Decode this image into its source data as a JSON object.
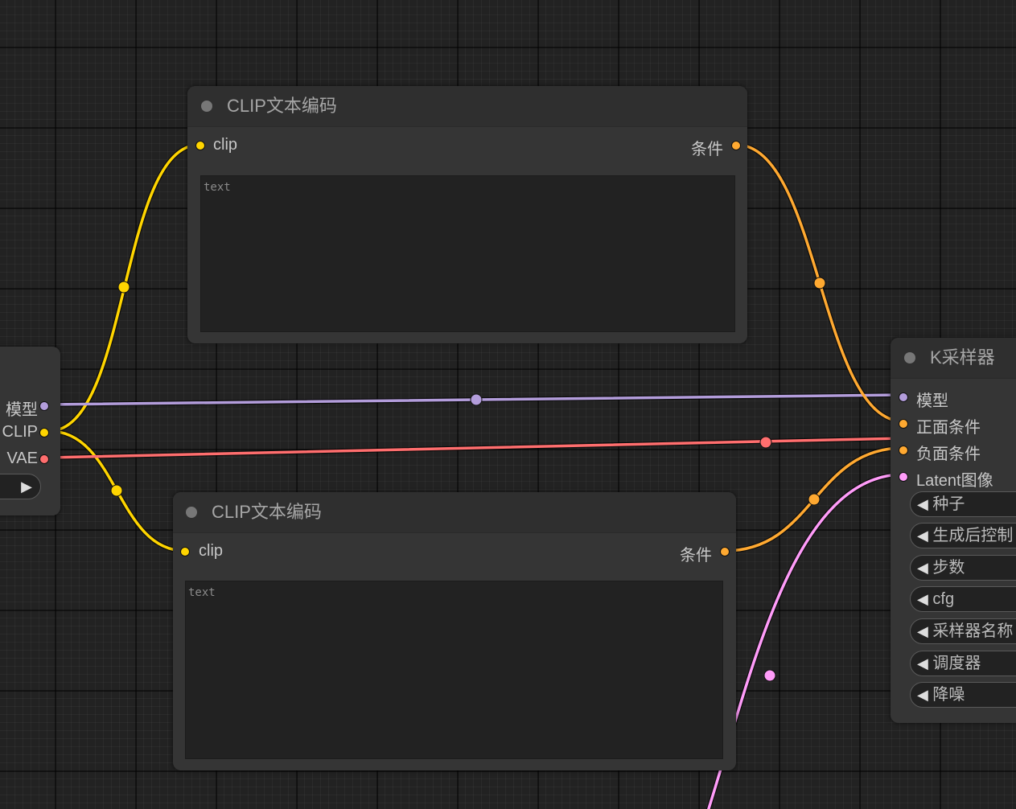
{
  "colors": {
    "clip": "#ffd500",
    "model": "#b39ddb",
    "vae": "#ff6e6e",
    "conditioning": "#ffa931",
    "latent": "#ff9cf9"
  },
  "loader_node": {
    "outputs": [
      {
        "label": "模型",
        "type": "model"
      },
      {
        "label": "CLIP",
        "type": "clip"
      },
      {
        "label": "VAE",
        "type": "vae"
      }
    ],
    "button_icon": "play-icon"
  },
  "clip_encode_top": {
    "title": "CLIP文本编码",
    "input_label": "clip",
    "output_label": "条件",
    "text_placeholder": "text"
  },
  "clip_encode_bottom": {
    "title": "CLIP文本编码",
    "input_label": "clip",
    "output_label": "条件",
    "text_placeholder": "text"
  },
  "ksampler": {
    "title": "K采样器",
    "inputs": [
      {
        "label": "模型",
        "type": "model"
      },
      {
        "label": "正面条件",
        "type": "conditioning"
      },
      {
        "label": "负面条件",
        "type": "conditioning"
      },
      {
        "label": "Latent图像",
        "type": "latent"
      }
    ],
    "widgets": [
      "种子",
      "生成后控制",
      "步数",
      "cfg",
      "采样器名称",
      "调度器",
      "降噪"
    ]
  }
}
